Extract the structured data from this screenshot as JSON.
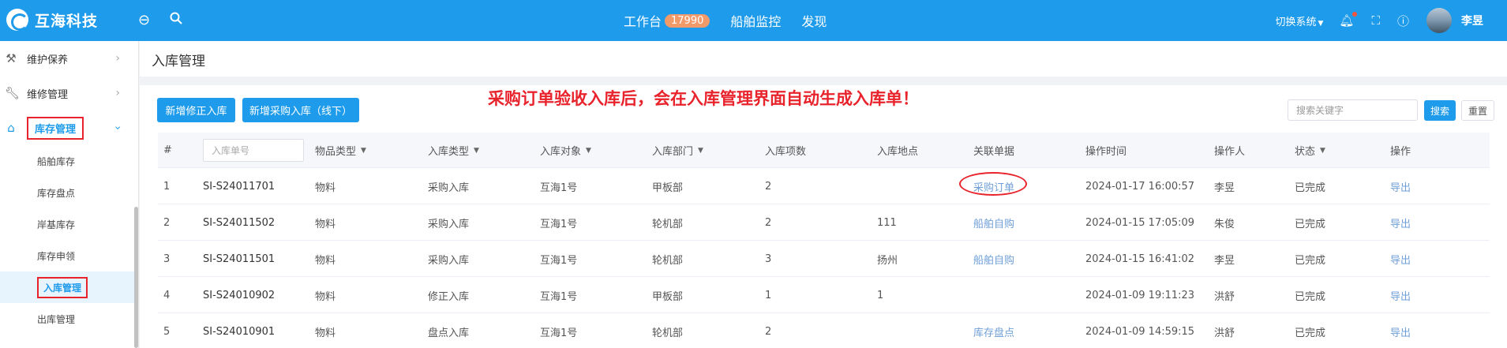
{
  "app": {
    "name": "互海科技"
  },
  "topnav": {
    "items": [
      {
        "label": "工作台",
        "badge": "17990"
      },
      {
        "label": "船舶监控"
      },
      {
        "label": "发现"
      }
    ]
  },
  "header_right": {
    "switch_label": "切换系统",
    "user_name": "李昱"
  },
  "sidebar": {
    "items": [
      {
        "label": "维护保养"
      },
      {
        "label": "维修管理"
      },
      {
        "label": "库存管理"
      }
    ],
    "sub_items": [
      "船舶库存",
      "库存盘点",
      "岸基库存",
      "库存申领",
      "入库管理",
      "出库管理"
    ]
  },
  "page": {
    "title": "入库管理"
  },
  "toolbar": {
    "btn_new_correction": "新增修正入库",
    "btn_new_purchase": "新增采购入库（线下）",
    "search_placeholder": "搜索关键字",
    "search_button": "搜索",
    "reset_button": "重置"
  },
  "annotation": "采购订单验收入库后，会在入库管理界面自动生成入库单！",
  "table": {
    "headers": {
      "num": "#",
      "code_placeholder": "入库单号",
      "item_type": "物品类型",
      "in_type": "入库类型",
      "target": "入库对象",
      "dept": "入库部门",
      "count": "入库项数",
      "location": "入库地点",
      "related": "关联单据",
      "time": "操作时间",
      "operator": "操作人",
      "status": "状态",
      "action": "操作"
    },
    "rows": [
      {
        "num": "1",
        "code": "SI-S24011701",
        "item_type": "物料",
        "in_type": "采购入库",
        "target": "互海1号",
        "dept": "甲板部",
        "count": "2",
        "location": "",
        "related": "采购订单",
        "time": "2024-01-17 16:00:57",
        "operator": "李昱",
        "status": "已完成",
        "action": "导出"
      },
      {
        "num": "2",
        "code": "SI-S24011502",
        "item_type": "物料",
        "in_type": "采购入库",
        "target": "互海1号",
        "dept": "轮机部",
        "count": "2",
        "location": "111",
        "related": "船舶自购",
        "time": "2024-01-15 17:05:09",
        "operator": "朱俊",
        "status": "已完成",
        "action": "导出"
      },
      {
        "num": "3",
        "code": "SI-S24011501",
        "item_type": "物料",
        "in_type": "采购入库",
        "target": "互海1号",
        "dept": "轮机部",
        "count": "3",
        "location": "扬州",
        "related": "船舶自购",
        "time": "2024-01-15 16:41:02",
        "operator": "李昱",
        "status": "已完成",
        "action": "导出"
      },
      {
        "num": "4",
        "code": "SI-S24010902",
        "item_type": "物料",
        "in_type": "修正入库",
        "target": "互海1号",
        "dept": "甲板部",
        "count": "1",
        "location": "1",
        "related": "",
        "time": "2024-01-09 19:11:23",
        "operator": "洪舒",
        "status": "已完成",
        "action": "导出"
      },
      {
        "num": "5",
        "code": "SI-S24010901",
        "item_type": "物料",
        "in_type": "盘点入库",
        "target": "互海1号",
        "dept": "轮机部",
        "count": "2",
        "location": "",
        "related": "库存盘点",
        "time": "2024-01-09 14:59:15",
        "operator": "洪舒",
        "status": "已完成",
        "action": "导出"
      }
    ]
  },
  "colors": {
    "primary": "#1e9bea",
    "annotation_red": "#e8232c",
    "link": "#6f9fd8",
    "badge": "#f39a6b"
  }
}
